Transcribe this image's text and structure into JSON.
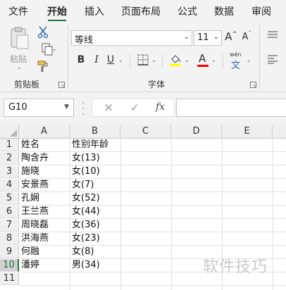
{
  "ribbon_tabs": [
    "文件",
    "开始",
    "插入",
    "页面布局",
    "公式",
    "数据",
    "审阅"
  ],
  "active_tab": "开始",
  "clipboard_group": {
    "paste_label": "粘贴",
    "group_label": "剪贴板"
  },
  "font_group": {
    "font_name": "等线",
    "font_size": "11",
    "bold_label": "B",
    "italic_label": "I",
    "underline_label": "U",
    "grow_label": "A",
    "shrink_label": "A",
    "font_color_label": "A",
    "phonetic_top": "wén",
    "phonetic_bottom": "文",
    "group_label": "字体"
  },
  "colors": {
    "accent": "#217346",
    "highlight_bar": "#ffff00",
    "font_color_bar": "#ff0000"
  },
  "formula_bar": {
    "name_box": "G10",
    "cancel_icon": "×",
    "enter_icon": "✓",
    "fx_label": "fx",
    "formula_value": ""
  },
  "grid": {
    "columns": [
      "A",
      "B",
      "C",
      "D",
      "E"
    ],
    "selected_column": "G",
    "selected_row": "10",
    "rows": [
      {
        "row": "1",
        "a": "姓名",
        "b": "性别年龄"
      },
      {
        "row": "2",
        "a": "陶含卉",
        "b": "女(13)"
      },
      {
        "row": "3",
        "a": "施晓",
        "b": "女(10)"
      },
      {
        "row": "4",
        "a": "安景燕",
        "b": "女(7)"
      },
      {
        "row": "5",
        "a": "孔娴",
        "b": "女(52)"
      },
      {
        "row": "6",
        "a": "王兰燕",
        "b": "女(44)"
      },
      {
        "row": "7",
        "a": "周晓磊",
        "b": "女(36)"
      },
      {
        "row": "8",
        "a": "洪海燕",
        "b": "女(23)"
      },
      {
        "row": "9",
        "a": "何融",
        "b": "女(8)"
      },
      {
        "row": "10",
        "a": "潘婷",
        "b": "男(34)"
      },
      {
        "row": "11",
        "a": "",
        "b": ""
      }
    ]
  },
  "watermark": "软件技巧"
}
